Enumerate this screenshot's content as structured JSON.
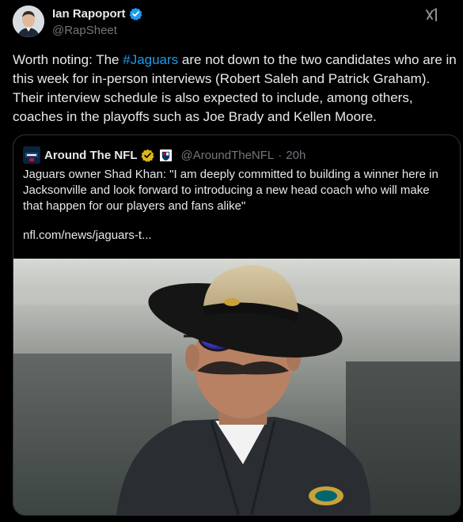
{
  "author": {
    "name": "Ian Rapoport",
    "handle": "@RapSheet"
  },
  "post": {
    "text_before": "Worth noting: The ",
    "hashtag": "#Jaguars",
    "text_after": " are not down to the two candidates who are in this week for in-person interviews (Robert Saleh and Patrick Graham). Their interview schedule is also expected to include, among others, coaches in the playoffs such as Joe Brady and Kellen Moore."
  },
  "quoted": {
    "name": "Around The NFL",
    "handle": "@AroundTheNFL",
    "separator": "·",
    "time": "20h",
    "text": "Jaguars owner Shad Khan: \"I am deeply committed to building a winner here in Jacksonville and look forward to introducing a new head coach who will make that happen for our players and fans alike\"",
    "link": "nfl.com/news/jaguars-t..."
  },
  "colors": {
    "background": "#000000",
    "text": "#e7e9ea",
    "secondary": "#71767b",
    "accent": "#1d9bf0",
    "verified_blue": "#1d9bf0",
    "verified_gold": "#e2b719",
    "border": "#2f3336"
  },
  "icons": {
    "verified": "verified-badge-icon",
    "grok": "grok-icon",
    "affiliate": "affiliate-badge-icon"
  }
}
